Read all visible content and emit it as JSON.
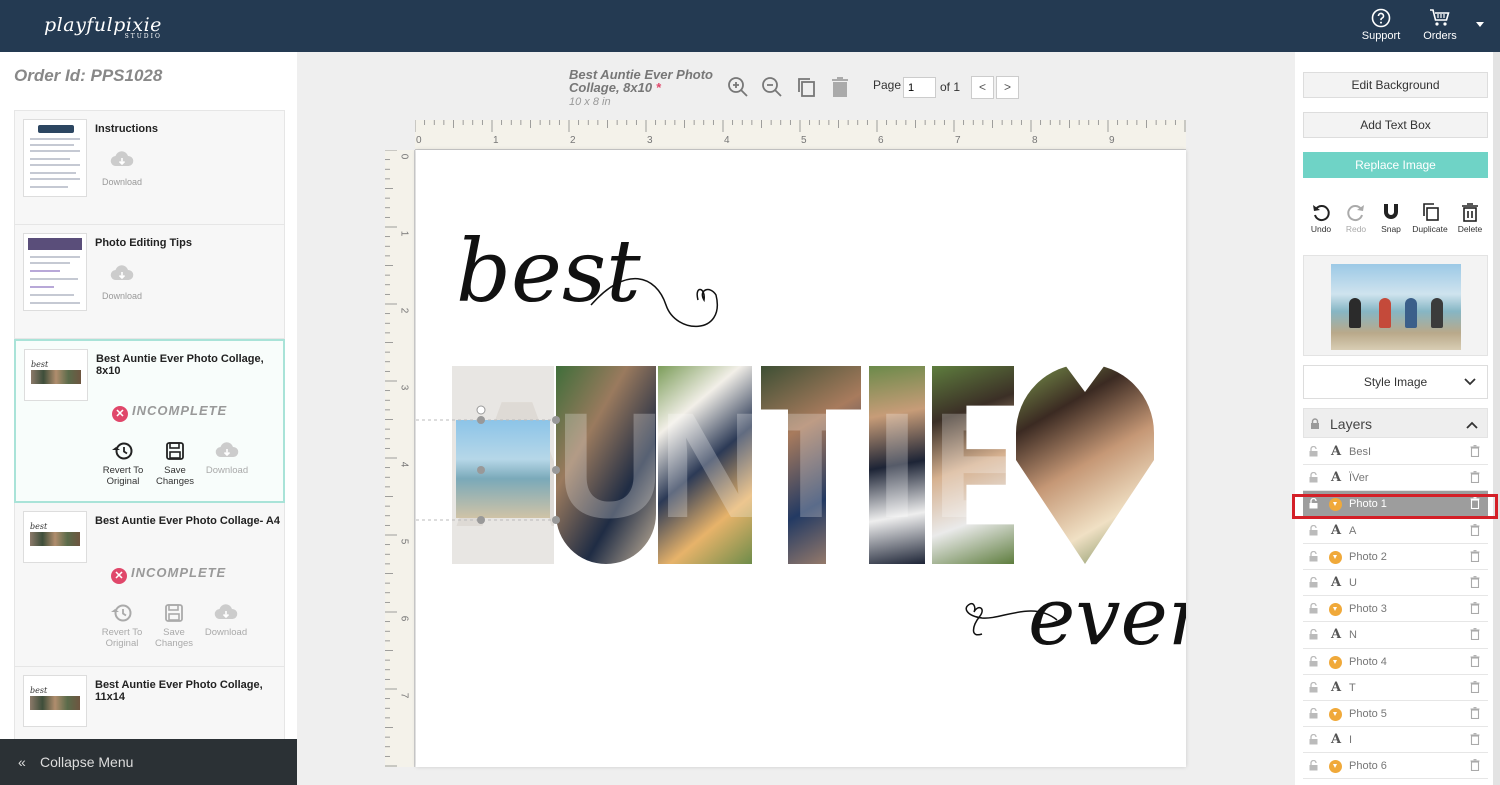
{
  "header": {
    "logo_text": "playfulpixie",
    "logo_sub": "STUDIO",
    "support_label": "Support",
    "orders_label": "Orders"
  },
  "order": {
    "label": "Order Id: PPS1028"
  },
  "files": [
    {
      "title": "Instructions",
      "download_label": "Download"
    },
    {
      "title": "Photo Editing Tips",
      "download_label": "Download"
    },
    {
      "title": "Best Auntie Ever Photo Collage, 8x10",
      "status": "INCOMPLETE",
      "revert_label": "Revert To Original",
      "save_label": "Save Changes",
      "download_label": "Download"
    },
    {
      "title": "Best Auntie Ever Photo Collage- A4",
      "status": "INCOMPLETE",
      "revert_label": "Revert To Original",
      "save_label": "Save Changes",
      "download_label": "Download"
    },
    {
      "title": "Best Auntie Ever Photo Collage, 11x14"
    }
  ],
  "collapse_label": "Collapse Menu",
  "document": {
    "title": "Best Auntie Ever Photo Collage, 8x10",
    "required_mark": "*",
    "size": "10 x 8 in",
    "page_label": "Page",
    "page_value": "1",
    "page_of": "of 1",
    "prev": "<",
    "next": ">"
  },
  "ruler": {
    "top_numbers": [
      "0",
      "1",
      "2",
      "3",
      "4",
      "5",
      "6",
      "7",
      "8",
      "9"
    ],
    "left_numbers": [
      "0",
      "1",
      "2",
      "3",
      "4",
      "5",
      "6",
      "7"
    ]
  },
  "artwork": {
    "word_best": "best",
    "word_ever": "ever",
    "big_letters": [
      "A",
      "U",
      "N",
      "T",
      "I",
      "E"
    ]
  },
  "right": {
    "edit_background": "Edit Background",
    "add_text_box": "Add Text Box",
    "replace_image": "Replace Image",
    "tools": [
      {
        "label": "Undo"
      },
      {
        "label": "Redo"
      },
      {
        "label": "Snap"
      },
      {
        "label": "Duplicate"
      },
      {
        "label": "Delete"
      }
    ],
    "style_image": "Style Image",
    "layers_title": "Layers",
    "layers": [
      {
        "type": "text",
        "name": "BesI"
      },
      {
        "type": "text",
        "name": "ÏVer"
      },
      {
        "type": "photo",
        "name": "Photo 1",
        "selected": true
      },
      {
        "type": "text",
        "name": "A"
      },
      {
        "type": "photo",
        "name": "Photo 2"
      },
      {
        "type": "text",
        "name": "U"
      },
      {
        "type": "photo",
        "name": "Photo 3"
      },
      {
        "type": "text",
        "name": "N"
      },
      {
        "type": "photo",
        "name": "Photo 4"
      },
      {
        "type": "text",
        "name": "T"
      },
      {
        "type": "photo",
        "name": "Photo 5"
      },
      {
        "type": "text",
        "name": "I"
      },
      {
        "type": "photo",
        "name": "Photo 6"
      }
    ]
  },
  "colors": {
    "header_bg": "#243a52",
    "accent_teal": "#6fd3c6",
    "incomplete_red": "#e0476a",
    "photo_layer_orange": "#f0a93a",
    "highlight_red": "#d41f27"
  }
}
